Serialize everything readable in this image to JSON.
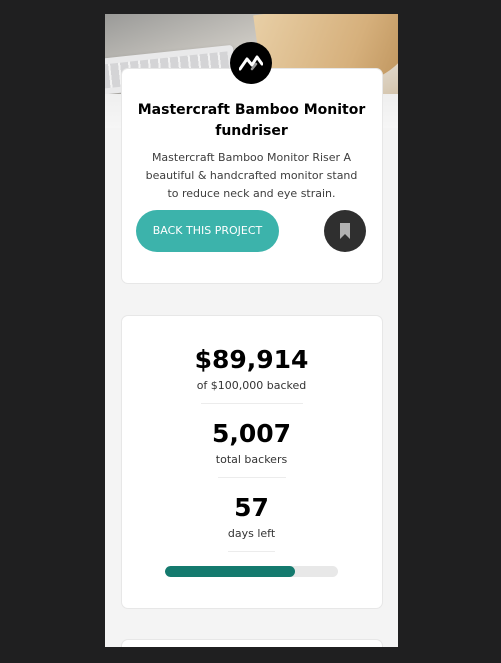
{
  "project": {
    "title": "Mastercraft Bamboo Monitor fundriser",
    "description": "Mastercraft Bamboo Monitor Riser A beautiful & handcrafted monitor stand to reduce neck and eye strain.",
    "back_button_label": "BACK THIS PROJECT",
    "logo_icon": "mastercraft-logo-icon",
    "bookmark_icon": "bookmark-icon"
  },
  "stats": {
    "backed_amount": "$89,914",
    "backed_label": "of $100,000 backed",
    "backers_count": "5,007",
    "backers_label": "total backers",
    "days_count": "57",
    "days_label": "days left",
    "progress_fraction": 0.75
  },
  "colors": {
    "page_background": "#1f1f20",
    "accent": "#3cb3ab",
    "accent_dark": "#147a6e",
    "bookmark_bg": "#2f2f2f"
  }
}
